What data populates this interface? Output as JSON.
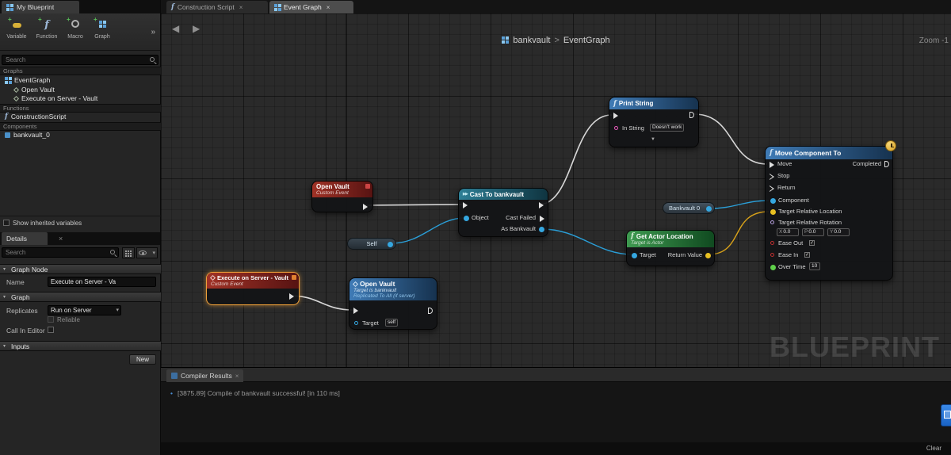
{
  "icons": {
    "close": "×",
    "chevrons": "»",
    "caret": "▾",
    "collapse": "▼",
    "back": "◀",
    "forward": "▶",
    "fn": "f",
    "cast": "▶▶",
    "bullet": "•",
    "check": "✓",
    "diamond_event": "◇"
  },
  "my_blueprint": {
    "tab": "My Blueprint",
    "toolbar": [
      {
        "label": "Variable"
      },
      {
        "label": "Function"
      },
      {
        "label": "Macro"
      },
      {
        "label": "Graph"
      }
    ],
    "search_placeholder": "Search",
    "graphs_header": "Graphs",
    "eventgraph": "EventGraph",
    "open_vault": "Open Vault",
    "execute_on_server": "Execute on Server - Vault",
    "functions_header": "Functions",
    "construction_script": "ConstructionScript",
    "components_header": "Components",
    "bankvault_component": "bankvault_0",
    "show_inherited": "Show inherited variables"
  },
  "details": {
    "tab": "Details",
    "search_placeholder": "Search",
    "graph_node_header": "Graph Node",
    "name_label": "Name",
    "name_value": "Execute on Server - Va",
    "graph_header": "Graph",
    "replicates_label": "Replicates",
    "replicates_value": "Run on Server",
    "reliable_label": "Reliable",
    "call_in_editor_label": "Call In Editor",
    "inputs_header": "Inputs",
    "new_button": "New"
  },
  "tabs": {
    "construction": "Construction Script",
    "event_graph": "Event Graph"
  },
  "graph": {
    "breadcrumb_root": "bankvault",
    "breadcrumb_sep": ">",
    "breadcrumb_current": "EventGraph",
    "zoom": "Zoom -1",
    "watermark": "BLUEPRINT"
  },
  "nodes": {
    "open_vault_event": {
      "title": "Open Vault",
      "subtitle": "Custom Event"
    },
    "execute_on_server": {
      "title": "Execute on Server - Vault",
      "subtitle": "Custom Event"
    },
    "open_vault_fn": {
      "title": "Open Vault",
      "desc1": "Target is bankvault",
      "desc2": "Replicated To All (if server)",
      "target_label": "Target",
      "target_value": "self"
    },
    "cast": {
      "title": "Cast To bankvault",
      "object_label": "Object",
      "cast_failed_label": "Cast Failed",
      "as_label": "As Bankvault"
    },
    "print_string": {
      "title": "Print String",
      "in_string_label": "In String",
      "in_string_value": "Doesn't work"
    },
    "get_actor_location": {
      "title": "Get Actor Location",
      "subtitle": "Target is Actor",
      "target_label": "Target",
      "return_label": "Return Value"
    },
    "bankvault_var": {
      "label": "Bankvault 0"
    },
    "self_var": {
      "label": "Self"
    },
    "move": {
      "title": "Move Component To",
      "completed": "Completed",
      "move": "Move",
      "stop": "Stop",
      "return": "Return",
      "component": "Component",
      "trl": "Target Relative Location",
      "trr": "Target Relative Rotation",
      "rx_label": "X",
      "rx": "0.0",
      "rp_label": "P",
      "rp": "0.0",
      "ry_label": "Y",
      "ry": "0.0",
      "ease_out": "Ease Out",
      "ease_in": "Ease In",
      "over_time": "Over Time",
      "over_time_value": "10"
    }
  },
  "compiler": {
    "tab": "Compiler Results",
    "message": "[3875.89] Compile of bankvault successful! [in 110 ms]",
    "clear": "Clear"
  }
}
